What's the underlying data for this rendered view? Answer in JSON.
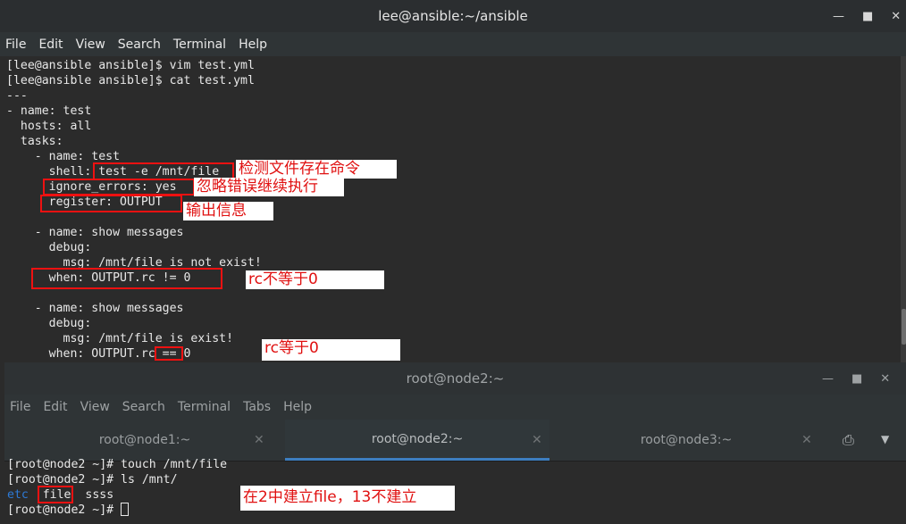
{
  "window1": {
    "title": "lee@ansible:~/ansible",
    "menu": [
      "File",
      "Edit",
      "View",
      "Search",
      "Terminal",
      "Help"
    ],
    "lines": [
      "[lee@ansible ansible]$ vim test.yml",
      "[lee@ansible ansible]$ cat test.yml",
      "---",
      "- name: test",
      "  hosts: all",
      "  tasks:",
      "    - name: test",
      "      shell: test -e /mnt/file",
      "      ignore_errors: yes",
      "      register: OUTPUT",
      "",
      "    - name: show messages",
      "      debug:",
      "        msg: /mnt/file is not exist!",
      "      when: OUTPUT.rc != 0",
      "",
      "    - name: show messages",
      "      debug:",
      "        msg: /mnt/file is exist!",
      "      when: OUTPUT.rc == 0"
    ]
  },
  "annotations": {
    "check_file": "检测文件存在命令",
    "ignore_errors": "忽略错误继续执行",
    "output_info": "输出信息",
    "rc_not_zero": "rc不等于0",
    "rc_zero": "rc等于0",
    "node2_note": "在2中建立file，13不建立"
  },
  "window2": {
    "title": "root@node2:~",
    "menu": [
      "File",
      "Edit",
      "View",
      "Search",
      "Terminal",
      "Tabs",
      "Help"
    ],
    "tabs": [
      "root@node1:~",
      "root@node2:~",
      "root@node3:~"
    ],
    "active_tab": "root@node2:~",
    "lines": {
      "l1": "[root@node2 ~]# touch /mnt/file",
      "l2": "[root@node2 ~]# ls /mnt/",
      "dir_etc": "etc",
      "file_name": "file",
      "file_ssss": "ssss",
      "prompt": "[root@node2 ~]# "
    }
  },
  "colors": {
    "accent": "#3d7ec0",
    "annotation_red": "#e01010",
    "dir_blue": "#2d7ad6"
  }
}
